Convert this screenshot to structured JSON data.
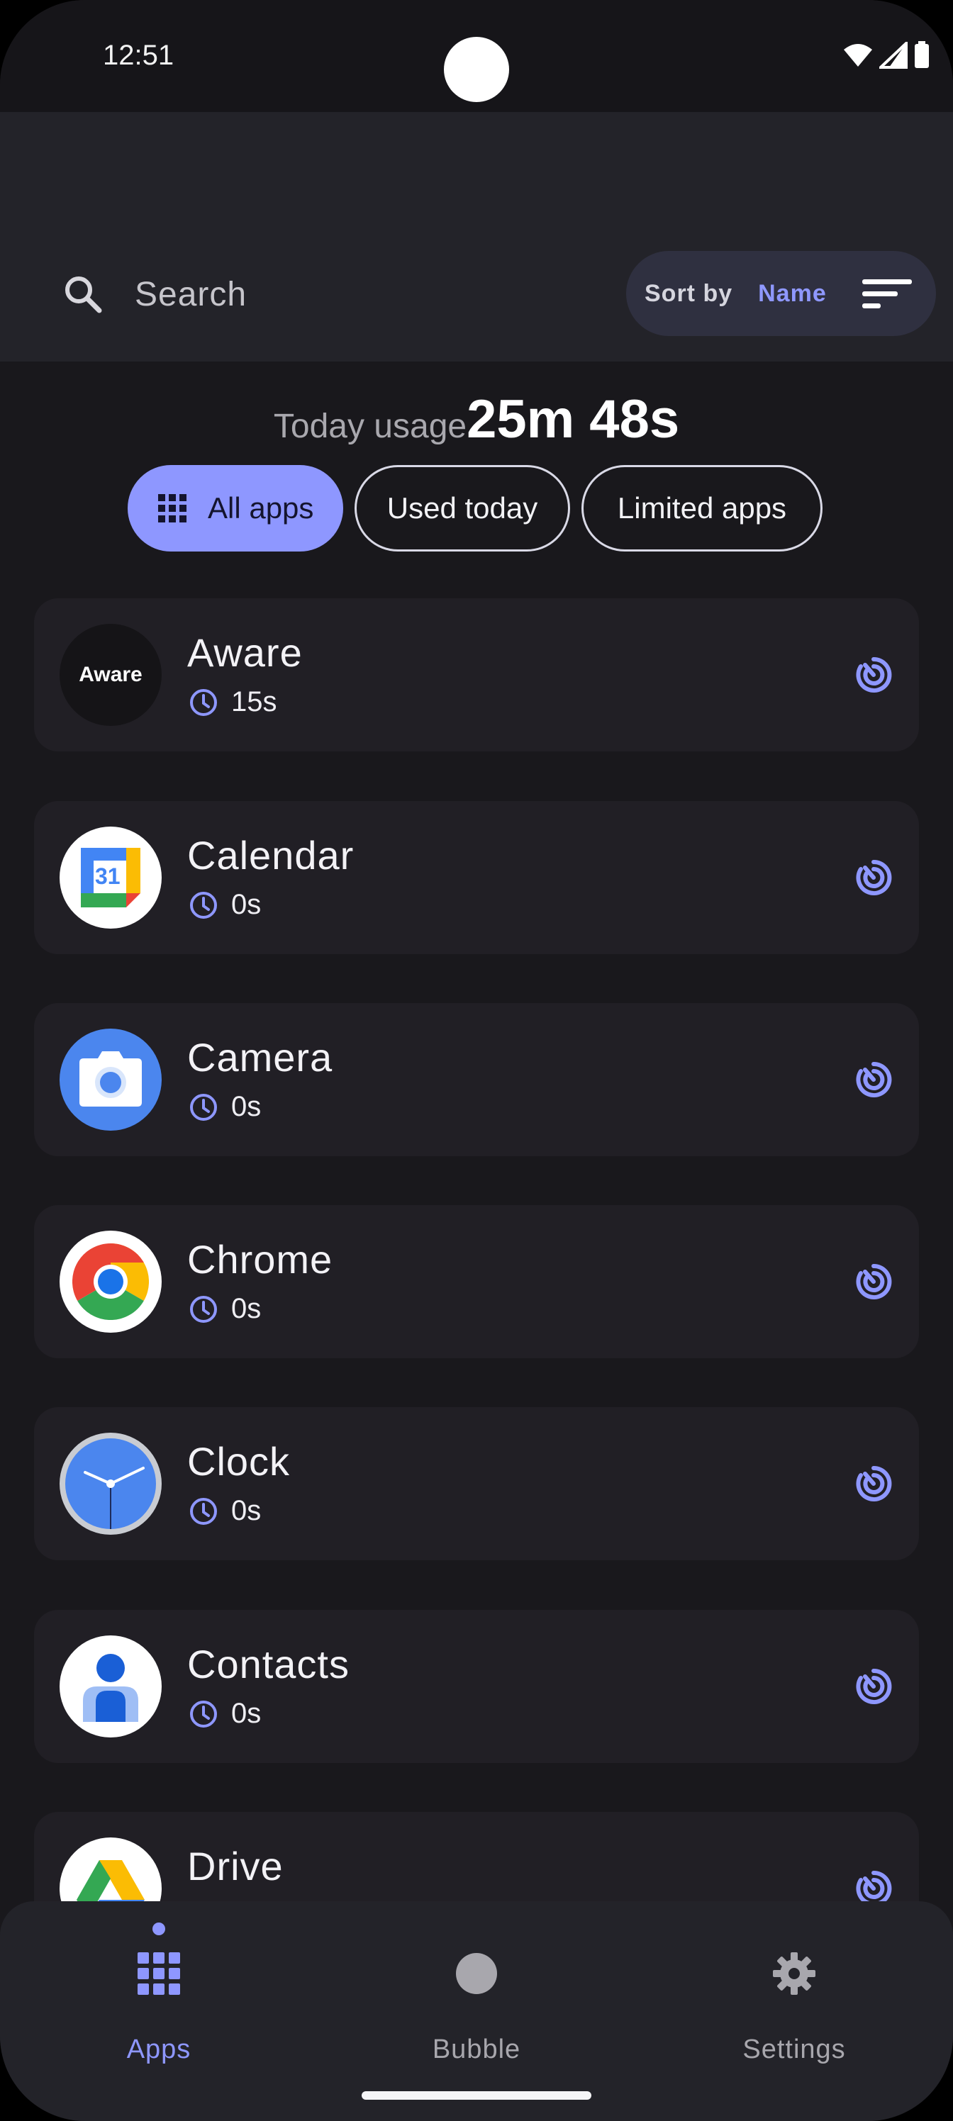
{
  "status": {
    "time": "12:51"
  },
  "search": {
    "placeholder": "Search"
  },
  "sort": {
    "label": "Sort by",
    "value": "Name"
  },
  "usage": {
    "label": "Today usage",
    "value": "25m 48s"
  },
  "filters": [
    {
      "label": "All apps",
      "active": true
    },
    {
      "label": "Used today",
      "active": false
    },
    {
      "label": "Limited apps",
      "active": false
    }
  ],
  "apps": [
    {
      "name": "Aware",
      "time": "15s",
      "icon": "aware-logo-icon",
      "logo_text": "Aware"
    },
    {
      "name": "Calendar",
      "time": "0s",
      "icon": "calendar-icon",
      "calendar_day": "31"
    },
    {
      "name": "Camera",
      "time": "0s",
      "icon": "camera-icon"
    },
    {
      "name": "Chrome",
      "time": "0s",
      "icon": "chrome-icon"
    },
    {
      "name": "Clock",
      "time": "0s",
      "icon": "clock-icon"
    },
    {
      "name": "Contacts",
      "time": "0s",
      "icon": "contacts-icon"
    },
    {
      "name": "Drive",
      "time": "",
      "icon": "drive-icon"
    }
  ],
  "nav": [
    {
      "label": "Apps",
      "icon": "grid-icon",
      "active": true
    },
    {
      "label": "Bubble",
      "icon": "bubble-icon",
      "active": false
    },
    {
      "label": "Settings",
      "icon": "gear-icon",
      "active": false
    }
  ],
  "colors": {
    "accent": "#8e97ff",
    "background": "#19181c",
    "card": "#211f25",
    "surface": "#232329"
  }
}
